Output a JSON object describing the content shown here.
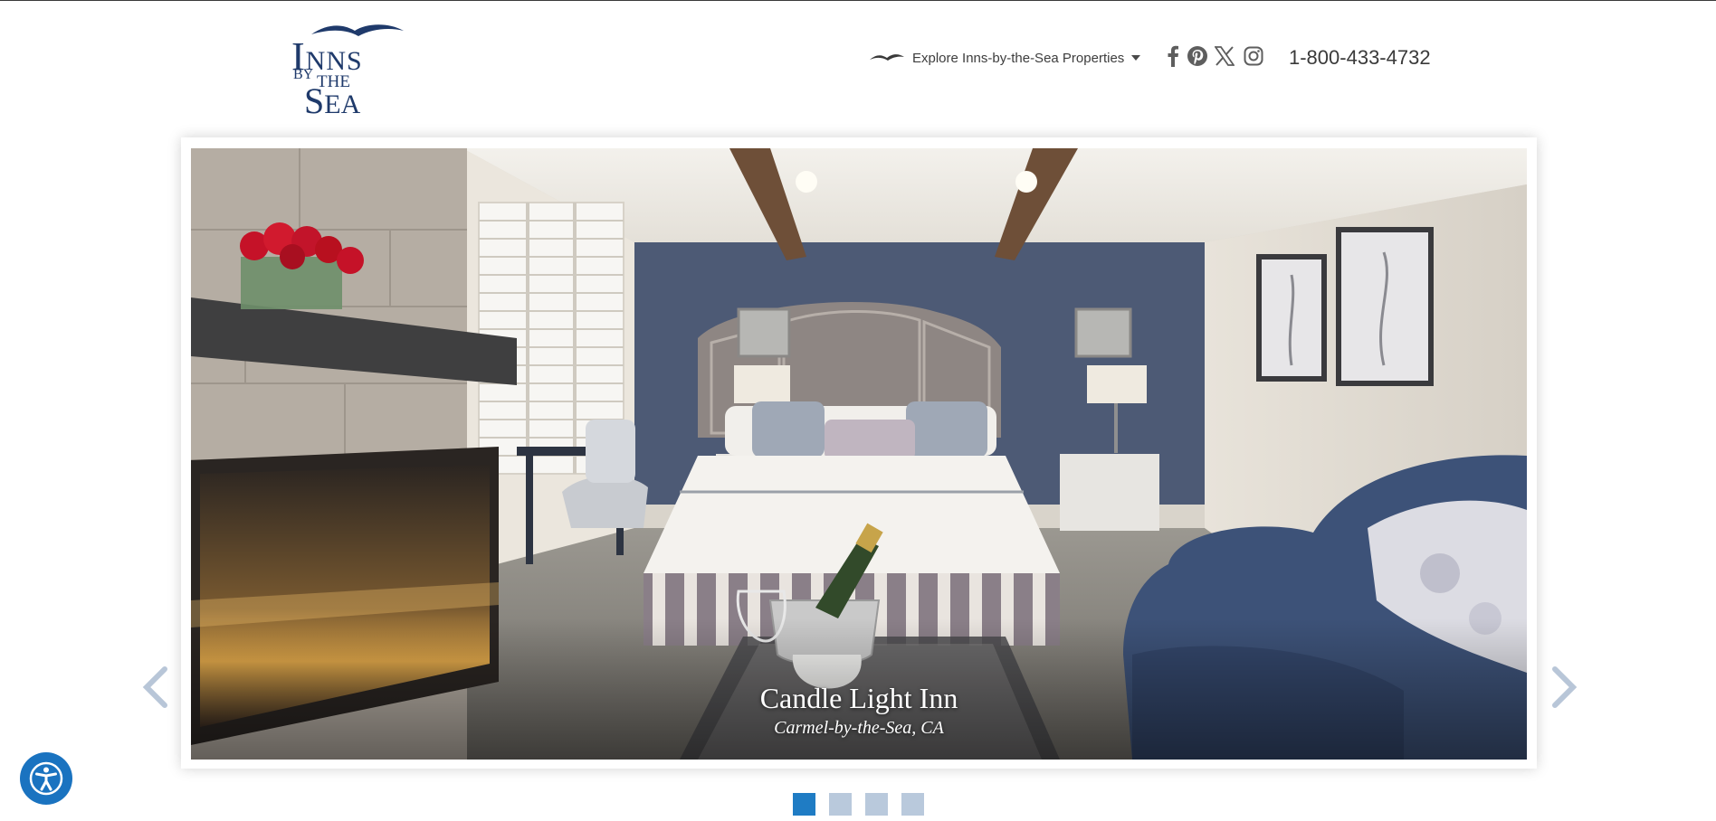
{
  "brand": {
    "logo_line1_cap": "I",
    "logo_line1_rest": "NNS",
    "logo_line2_by": "BY",
    "logo_line2_the": "THE",
    "logo_line3_cap": "S",
    "logo_line3_rest": "EA",
    "color": "#1f3a6b"
  },
  "header": {
    "explore_label": "Explore Inns-by-the-Sea Properties",
    "explore_icon": "seagull-icon",
    "social": [
      "facebook-icon",
      "pinterest-icon",
      "x-icon",
      "instagram-icon"
    ],
    "phone": "1-800-433-4732"
  },
  "hero": {
    "title": "Candle Light Inn",
    "subtitle": "Carmel-by-the-Sea, CA",
    "prev_icon": "chevron-left-icon",
    "next_icon": "chevron-right-icon"
  },
  "carousel": {
    "slides": 4,
    "active_index": 0,
    "active_color": "#1f7cc4",
    "inactive_color": "#b9c9dc"
  },
  "accessibility": {
    "icon": "accessibility-icon",
    "color": "#1a73c0"
  }
}
